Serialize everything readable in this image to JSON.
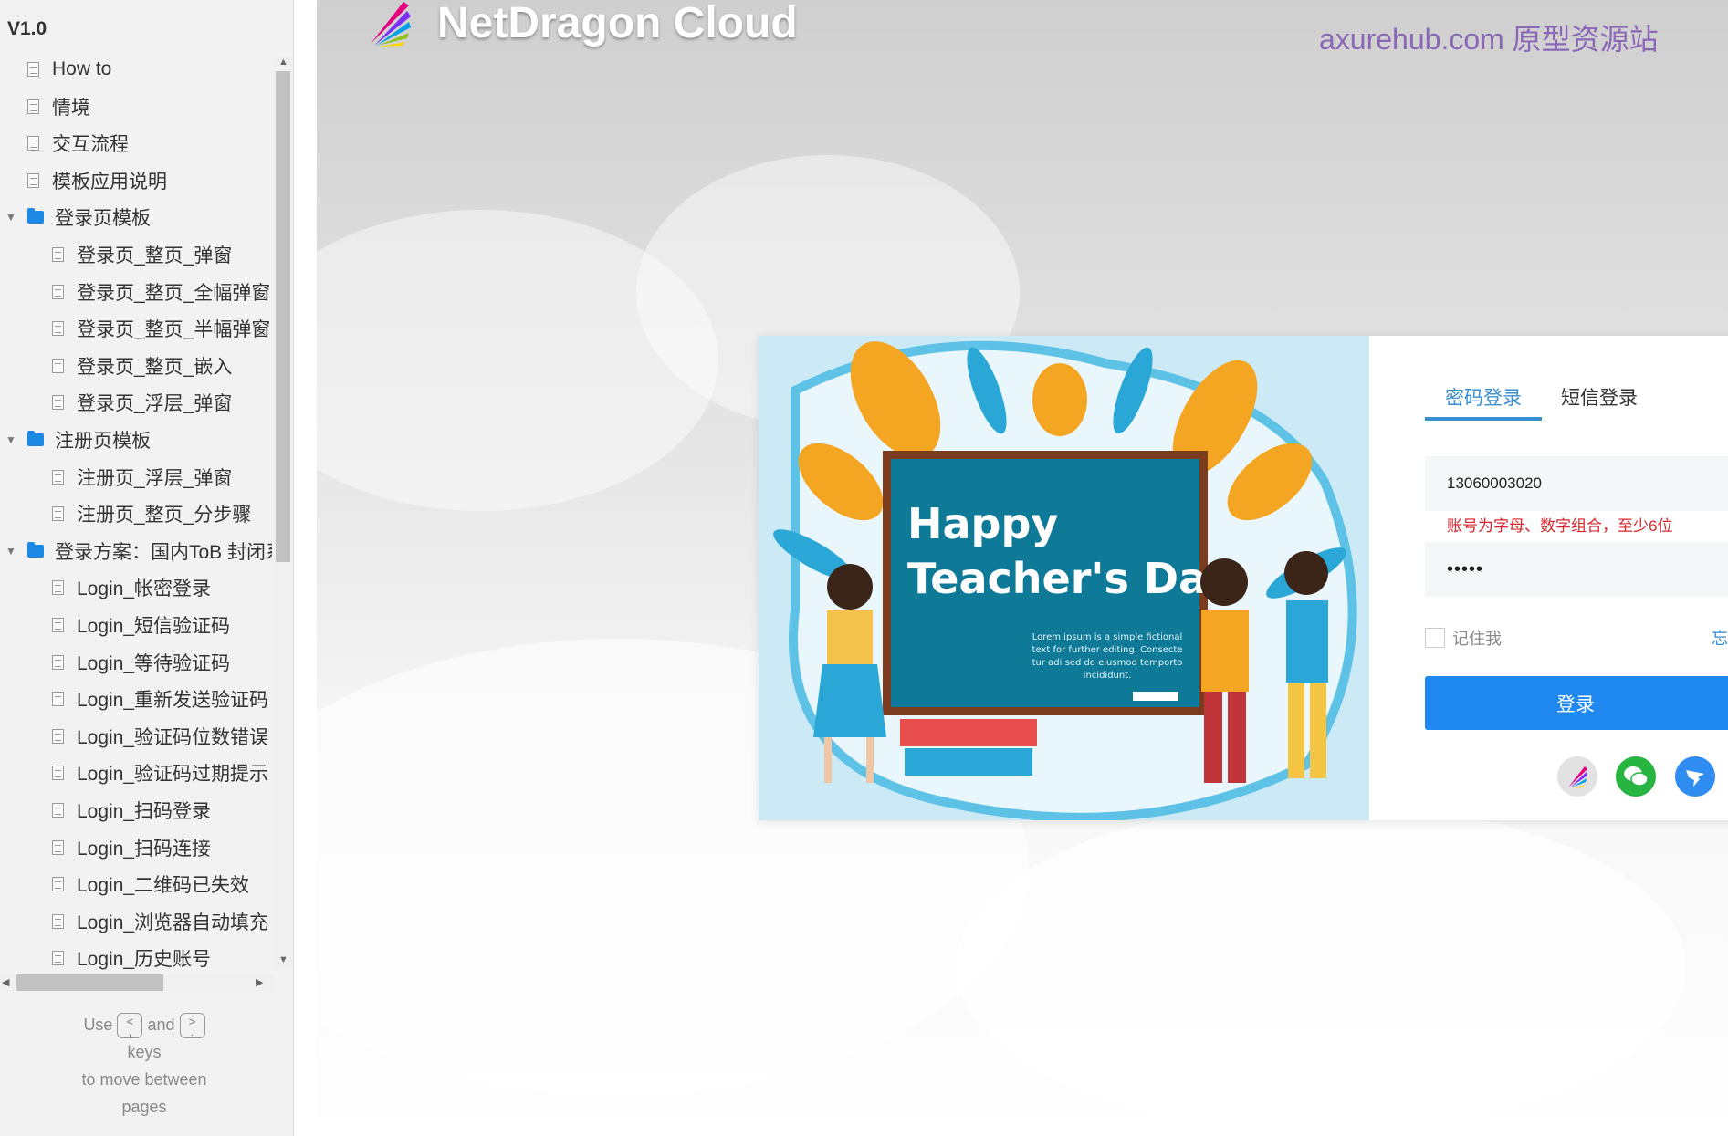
{
  "sidebar": {
    "version": "V1.0",
    "items": [
      {
        "label": "How to",
        "type": "page",
        "level": 0
      },
      {
        "label": "情境",
        "type": "page",
        "level": 0
      },
      {
        "label": "交互流程",
        "type": "page",
        "level": 0
      },
      {
        "label": "模板应用说明",
        "type": "page",
        "level": 0
      },
      {
        "label": "登录页模板",
        "type": "folder",
        "level": 0
      },
      {
        "label": "登录页_整页_弹窗",
        "type": "page",
        "level": 1
      },
      {
        "label": "登录页_整页_全幅弹窗",
        "type": "page",
        "level": 1
      },
      {
        "label": "登录页_整页_半幅弹窗",
        "type": "page",
        "level": 1
      },
      {
        "label": "登录页_整页_嵌入",
        "type": "page",
        "level": 1
      },
      {
        "label": "登录页_浮层_弹窗",
        "type": "page",
        "level": 1
      },
      {
        "label": "注册页模板",
        "type": "folder",
        "level": 0
      },
      {
        "label": "注册页_浮层_弹窗",
        "type": "page",
        "level": 1
      },
      {
        "label": "注册页_整页_分步骤",
        "type": "page",
        "level": 1
      },
      {
        "label": "登录方案：国内ToB 封闭系统",
        "type": "folder",
        "level": 0
      },
      {
        "label": "Login_帐密登录",
        "type": "page",
        "level": 1
      },
      {
        "label": "Login_短信验证码",
        "type": "page",
        "level": 1
      },
      {
        "label": "Login_等待验证码",
        "type": "page",
        "level": 1
      },
      {
        "label": "Login_重新发送验证码",
        "type": "page",
        "level": 1
      },
      {
        "label": "Login_验证码位数错误",
        "type": "page",
        "level": 1
      },
      {
        "label": "Login_验证码过期提示",
        "type": "page",
        "level": 1
      },
      {
        "label": "Login_扫码登录",
        "type": "page",
        "level": 1
      },
      {
        "label": "Login_扫码连接",
        "type": "page",
        "level": 1
      },
      {
        "label": "Login_二维码已失效",
        "type": "page",
        "level": 1
      },
      {
        "label": "Login_浏览器自动填充",
        "type": "page",
        "level": 1
      },
      {
        "label": "Login_历史账号",
        "type": "page",
        "level": 1
      }
    ],
    "hint": {
      "use": "Use",
      "prev_key_top": "<",
      "prev_key_bottom": ",",
      "and": "and",
      "next_key_top": ">",
      "next_key_bottom": ".",
      "keys": "keys",
      "line3": "to move between",
      "line4": "pages"
    }
  },
  "header": {
    "brand": "NetDragon Cloud",
    "watermark": "axurehub.com 原型资源站"
  },
  "illustration": {
    "title_line1": "Happy",
    "title_line2": "Teacher's Day",
    "body": [
      "Lorem ipsum is a simple fictional",
      "text for further editing. Consecte",
      "tur adi sed do eiusmod temporto",
      "incididunt."
    ]
  },
  "login": {
    "tabs": [
      {
        "label": "密码登录",
        "active": true
      },
      {
        "label": "短信登录",
        "active": false
      }
    ],
    "account_value": "13060003020",
    "error": "账号为字母、数字组合，至少6位",
    "password_value": "•••••",
    "remember": "记住我",
    "remember_checked": false,
    "forgot": "忘",
    "submit": "登录",
    "social": [
      "netdragon-icon",
      "wechat-icon",
      "dingtalk-icon"
    ]
  },
  "colors": {
    "accent": "#1e88f0",
    "error": "#d8262c",
    "tab_active": "#3a8fd0",
    "watermark": "#8b67b8"
  }
}
